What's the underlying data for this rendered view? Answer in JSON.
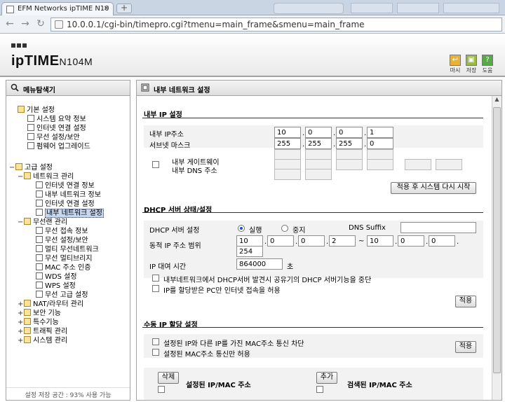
{
  "browser": {
    "tab_title": "EFM Networks ipTIME N10",
    "address": "10.0.0.1/cgi-bin/timepro.cgi?tmenu=main_frame&smenu=main_frame"
  },
  "header": {
    "logo_main": "ipTIME",
    "logo_model": "N104M",
    "buttons": [
      {
        "label": "마시",
        "icon": "logout-icon"
      },
      {
        "label": "저장",
        "icon": "save-icon"
      },
      {
        "label": "도움",
        "icon": "help-icon"
      }
    ]
  },
  "left": {
    "title": "메뉴탐색기",
    "basic": {
      "label": "기본 설정",
      "items": [
        "시스템 요약 정보",
        "인터넷 연결 설정",
        "무선 설정/보안",
        "펌웨어 업그레이드"
      ]
    },
    "advanced": {
      "label": "고급 설정",
      "network": {
        "label": "네트워크 관리",
        "items": [
          "인터넷 연결 정보",
          "내부 네트워크 정보",
          "인터넷 연결 설정",
          "내부 네트워크 설정"
        ]
      },
      "wireless": {
        "label": "무선랜 관리",
        "items": [
          "무선 접속 정보",
          "무선 설정/보안",
          "멀티 무선네트워크",
          "무선 멀티브리지",
          "MAC 주소 인증",
          "WDS 설정",
          "WPS 설정",
          "무선 고급 설정"
        ]
      },
      "others": [
        "NAT/라우터 관리",
        "보안 기능",
        "특수기능",
        "트래픽 관리",
        "시스템 관리"
      ]
    },
    "status": "설정 저장 공간 : 93% 사용 가능"
  },
  "main": {
    "title": "내부 네트워크 설정",
    "lan": {
      "section": "내부 IP 설정",
      "ip_label": "내부 IP주소",
      "ip": [
        "10",
        "0",
        "0",
        "1"
      ],
      "mask_label": "서브넷 마스크",
      "mask": [
        "255",
        "255",
        "255",
        "0"
      ],
      "gw_label": "내부 게이트웨이",
      "dns_label": "내부 DNS 주소",
      "apply_restart": "적용 후 시스템 다시 시작"
    },
    "dhcp": {
      "section": "DHCP 서버 상태/설정",
      "server_label": "DHCP 서버 설정",
      "run": "실행",
      "stop": "중지",
      "dns_suffix_label": "DNS Suffix",
      "dns_suffix": "",
      "range_label": "동적 IP 주소 범위",
      "range_start": [
        "10",
        "0",
        "0",
        "2"
      ],
      "range_tilde": "~",
      "range_end": [
        "10",
        "0",
        "0",
        "254"
      ],
      "lease_label": "IP 대여 시간",
      "lease": "864000",
      "lease_unit": "초",
      "opt1": "내부네트워크에서 DHCP서버 발견시 공유기의 DHCP 서버기능을 중단",
      "opt2": "IP를 할당받은 PC만 인터넷 접속을 허용",
      "apply": "적용"
    },
    "manual": {
      "section": "수동 IP 할당 설정",
      "opt1": "설정된 IP와 다른 IP를 가진 MAC주소 통신 차단",
      "opt2": "설정된 MAC주소 통신만 허용",
      "apply": "적용",
      "delete": "삭제",
      "set_list": "설정된 IP/MAC 주소",
      "add": "추가",
      "found_list": "검색된 IP/MAC 주소"
    }
  },
  "colors": {
    "header_bg": "#e9e9e9",
    "selected_bg": "#c7d7ef",
    "radio_dot": "#1f4fbf"
  }
}
